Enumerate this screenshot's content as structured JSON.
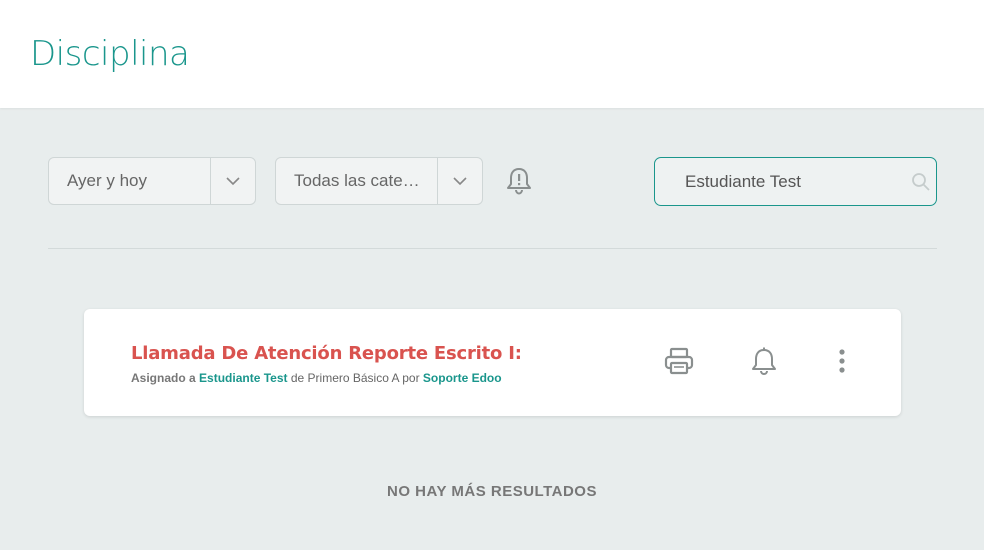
{
  "header": {
    "title": "Disciplina"
  },
  "filters": {
    "date_range": "Ayer y hoy",
    "category": "Todas las cate…"
  },
  "search": {
    "value": "Estudiante Test"
  },
  "results": [
    {
      "title": "Llamada De Atención Reporte Escrito I:",
      "assigned_prefix": "Asignado a",
      "student": "Estudiante Test",
      "group_text": "de Primero Básico A por",
      "author": "Soporte Edoo"
    }
  ],
  "footer": {
    "no_more": "NO HAY MÁS RESULTADOS"
  },
  "colors": {
    "accent": "#1a968c",
    "title_red": "#d9534f",
    "background": "#e8eded"
  },
  "icons": [
    "chevron-down-icon",
    "bell-alert-icon",
    "search-icon",
    "printer-icon",
    "bell-icon",
    "more-vertical-icon"
  ]
}
